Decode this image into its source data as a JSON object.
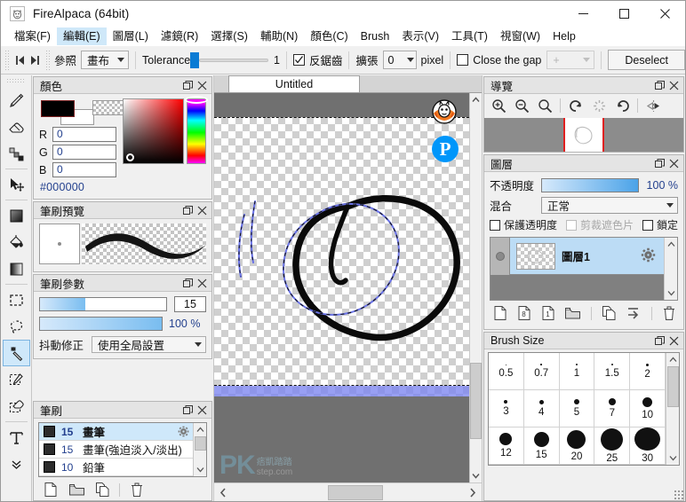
{
  "window": {
    "title": "FireAlpaca (64bit)",
    "app_icon": "alpaca-icon",
    "minimize": "—",
    "maximize": "□",
    "close": "✕"
  },
  "menubar": {
    "items": [
      {
        "label": "檔案(F)",
        "selected": false
      },
      {
        "label": "編輯(E)",
        "selected": true
      },
      {
        "label": "圖層(L)",
        "selected": false
      },
      {
        "label": "濾鏡(R)",
        "selected": false
      },
      {
        "label": "選擇(S)",
        "selected": false
      },
      {
        "label": "輔助(N)",
        "selected": false
      },
      {
        "label": "顏色(C)",
        "selected": false
      },
      {
        "label": "Brush",
        "selected": false
      },
      {
        "label": "表示(V)",
        "selected": false
      },
      {
        "label": "工具(T)",
        "selected": false
      },
      {
        "label": "視窗(W)",
        "selected": false
      },
      {
        "label": "Help",
        "selected": false
      }
    ]
  },
  "optionbar": {
    "prev_label": "step-back-icon",
    "next_label": "step-forward-icon",
    "reference_label": "參照",
    "reference_value": "畫布",
    "tolerance_label": "Tolerance",
    "tolerance_value": "1",
    "antialias_label": "反鋸齒",
    "antialias_checked": true,
    "expand_label": "擴張",
    "expand_value": "0",
    "pixel_label": "pixel",
    "close_gap_label": "Close the gap",
    "close_gap_checked": false,
    "gap_value": "+",
    "deselect_label": "Deselect"
  },
  "toolbar": {
    "tools": [
      {
        "name": "pen-tool",
        "selected": false
      },
      {
        "name": "eraser-tool",
        "selected": false
      },
      {
        "name": "smudge-tool",
        "selected": false
      },
      {
        "name": "move-tool",
        "selected": false
      },
      {
        "name": "fill-square-tool",
        "selected": false
      },
      {
        "name": "bucket-tool",
        "selected": false
      },
      {
        "name": "gradient-tool",
        "selected": false
      },
      {
        "name": "rect-select-tool",
        "selected": false
      },
      {
        "name": "lasso-select-tool",
        "selected": false
      },
      {
        "name": "magic-wand-tool",
        "selected": true
      },
      {
        "name": "select-pen-tool",
        "selected": false
      },
      {
        "name": "select-eraser-tool",
        "selected": false
      },
      {
        "name": "text-tool",
        "selected": false
      },
      {
        "name": "more-tools",
        "selected": false
      }
    ]
  },
  "color_panel": {
    "title": "顏色",
    "foreground": "#000000",
    "background": "#ffffff",
    "r_label": "R",
    "r_value": "0",
    "g_label": "G",
    "g_value": "0",
    "b_label": "B",
    "b_value": "0",
    "hex": "#000000"
  },
  "brush_preview": {
    "title": "筆刷預覽"
  },
  "brush_params": {
    "title": "筆刷參數",
    "size_value": "15",
    "size_fill_pct": 36,
    "opacity_value": "100 %",
    "opacity_fill_pct": 100,
    "stabilizer_label": "抖動修正",
    "stabilizer_value": "使用全局設置"
  },
  "brush_panel": {
    "title": "筆刷",
    "items": [
      {
        "size": "15",
        "name": "畫筆",
        "selected": true
      },
      {
        "size": "15",
        "name": "畫筆(強迫淡入/淡出)",
        "selected": false
      },
      {
        "size": "10",
        "name": "鉛筆",
        "selected": false
      }
    ],
    "footer_icons": [
      "new-brush-icon",
      "folder-icon",
      "duplicate-brush-icon",
      "delete-brush-icon"
    ]
  },
  "canvas": {
    "tab_label": "Untitled",
    "watermark_primary": "PK",
    "watermark_cjk": "痞凱踏踏",
    "watermark_domain": "step.com",
    "logo_icon": "alpaca-logo",
    "pixiv_icon": "pixiv-p-icon"
  },
  "navigator": {
    "title": "導覽",
    "tools": [
      "zoom-in-icon",
      "zoom-out-icon",
      "zoom-reset-icon",
      "rotate-left-icon",
      "rotate-reset-icon",
      "rotate-right-icon",
      "flip-icon"
    ]
  },
  "layer_panel": {
    "title": "圖層",
    "opacity_label": "不透明度",
    "opacity_value": "100 %",
    "blend_label": "混合",
    "blend_value": "正常",
    "protect_alpha_label": "保護透明度",
    "clipping_label": "剪裁遮色片",
    "lock_label": "鎖定",
    "layers": [
      {
        "name": "圖層1",
        "selected": true,
        "visible": true
      }
    ],
    "footer_icons": [
      "new-layer-icon",
      "new-8bit-layer-icon",
      "new-1bit-layer-icon",
      "new-folder-icon",
      "duplicate-layer-icon",
      "merge-down-icon",
      "delete-layer-icon"
    ]
  },
  "brush_size_panel": {
    "title": "Brush Size",
    "sizes": [
      {
        "label": "0.5",
        "dot": 1
      },
      {
        "label": "0.7",
        "dot": 1.5
      },
      {
        "label": "1",
        "dot": 2
      },
      {
        "label": "1.5",
        "dot": 2.5
      },
      {
        "label": "2",
        "dot": 3
      },
      {
        "label": "3",
        "dot": 4
      },
      {
        "label": "4",
        "dot": 5
      },
      {
        "label": "5",
        "dot": 6
      },
      {
        "label": "7",
        "dot": 8
      },
      {
        "label": "10",
        "dot": 11
      },
      {
        "label": "12",
        "dot": 14
      },
      {
        "label": "15",
        "dot": 17
      },
      {
        "label": "20",
        "dot": 21
      },
      {
        "label": "25",
        "dot": 25
      },
      {
        "label": "30",
        "dot": 29
      }
    ]
  },
  "accent_colors": {
    "selection_blue": "#6b74e8",
    "slider_blue": "#0a7bd4",
    "highlight": "#cfe8fa",
    "guide_red": "#e02020",
    "pixiv_blue": "#0096fa"
  }
}
